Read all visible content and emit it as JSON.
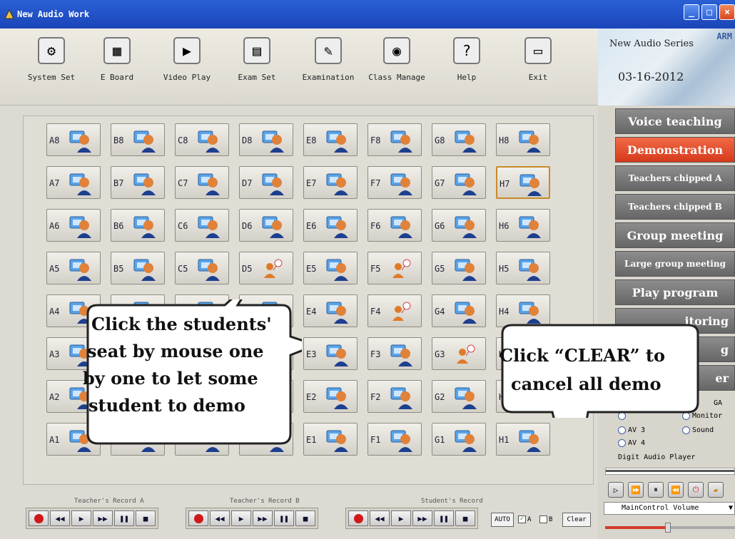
{
  "window": {
    "title": "New Audio Work"
  },
  "toolbar": [
    {
      "label": "System Set",
      "icon": "gears-icon"
    },
    {
      "label": "E Board",
      "icon": "board-icon"
    },
    {
      "label": "Video Play",
      "icon": "film-icon"
    },
    {
      "label": "Exam Set",
      "icon": "document-icon"
    },
    {
      "label": "Examination",
      "icon": "exam-icon"
    },
    {
      "label": "Class Manage",
      "icon": "palette-icon"
    },
    {
      "label": "Help",
      "icon": "help-icon"
    },
    {
      "label": "Exit",
      "icon": "monitor-icon"
    }
  ],
  "brand": {
    "series": "New Audio Series",
    "arm": "ARM",
    "date": "03-16-2012"
  },
  "seats": {
    "columns": [
      "A",
      "B",
      "C",
      "D",
      "E",
      "F",
      "G",
      "H"
    ],
    "rows": [
      "8",
      "7",
      "6",
      "5",
      "4",
      "3",
      "2",
      "1"
    ],
    "demo_seats": [
      "D5",
      "F5",
      "F4",
      "G3"
    ],
    "selected_seat": "H7"
  },
  "callouts": {
    "left": [
      "Click the students'",
      "seat by mouse one",
      "by one to let some",
      "student to demo"
    ],
    "right": [
      "Click “CLEAR” to",
      "cancel all demo"
    ]
  },
  "modes": [
    {
      "label": "Voice teaching",
      "active": false
    },
    {
      "label": "Demonstration",
      "active": true
    },
    {
      "label": "Teachers chipped A",
      "active": false
    },
    {
      "label": "Teachers chipped B",
      "active": false
    },
    {
      "label": "Group meeting",
      "active": false
    },
    {
      "label": "Large group meeting",
      "active": false
    },
    {
      "label": "Play program",
      "active": false
    },
    {
      "label": "itoring",
      "active": false
    },
    {
      "label": "g",
      "active": false
    },
    {
      "label": "er",
      "active": false
    }
  ],
  "av_sources": {
    "vga": "GA",
    "monitor": "Monitor",
    "av3": "AV 3",
    "sound": "Sound",
    "av4": "AV 4"
  },
  "player": {
    "label": "Digit Audio Player",
    "volume_select": "MainControl Volume",
    "volume_level": 0.48
  },
  "recorders": {
    "teacher_a": "Teacher's Record A",
    "teacher_b": "Teacher's Record B",
    "student": "Student's Record"
  },
  "controls": {
    "auto": "AUTO",
    "check_a": "A",
    "check_b": "B",
    "clear": "Clear"
  },
  "colors": {
    "active_mode": "#e04526",
    "mode": "#7a7a7a",
    "titlebar": "#2358d0"
  }
}
